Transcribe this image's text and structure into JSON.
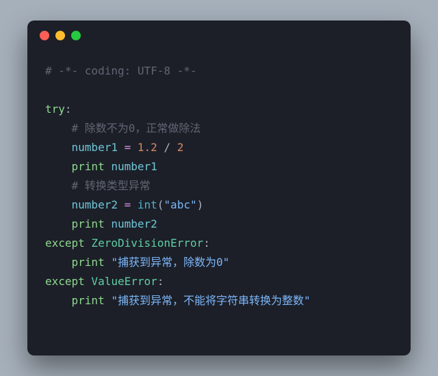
{
  "code": {
    "l1": "# -*- coding: UTF-8 -*-",
    "l3_try": "try",
    "l4_cm": "# 除数不为0，正常做除法",
    "l5_var": "number1",
    "l5_eq": " = ",
    "l5_n1": "1.2",
    "l5_div": " / ",
    "l5_n2": "2",
    "l6_print": "print",
    "l6_arg": " number1",
    "l7_cm": "# 转换类型异常",
    "l8_var": "number2",
    "l8_eq": " = ",
    "l8_fn": "int",
    "l8_lp": "(",
    "l8_str": "\"abc\"",
    "l8_rp": ")",
    "l9_print": "print",
    "l9_arg": " number2",
    "l10_except": "except",
    "l10_err": " ZeroDivisionError",
    "l10_colon": ":",
    "l11_print": "print",
    "l11_str": " \"捕获到异常，除数为0\"",
    "l12_except": "except",
    "l12_err": " ValueError",
    "l12_colon": ":",
    "l13_print": "print",
    "l13_str": " \"捕获到异常，不能将字符串转换为整数\"",
    "colon": ":"
  }
}
